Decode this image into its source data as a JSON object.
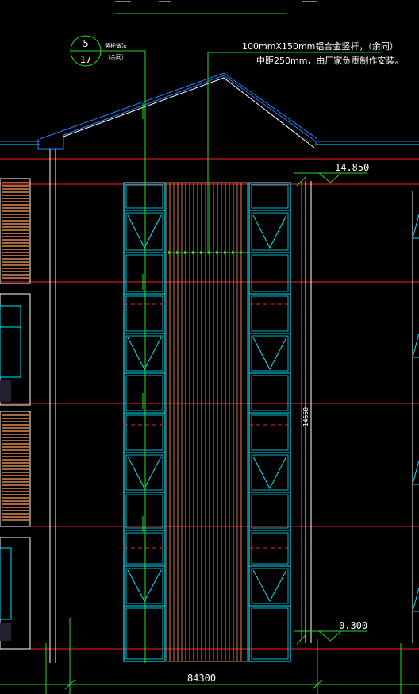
{
  "annotation": {
    "line1": "100mmX150mm铝合金竖杆，（余同）",
    "line2": "中距250mm，由厂家负责制作安装。"
  },
  "detail_callout": {
    "number": "5",
    "sheet": "17",
    "label_line1": "竖杆做法",
    "label_line2": "（余同）"
  },
  "elevation_marks": {
    "top": "14.850",
    "bottom": "0.300"
  },
  "dimensions": {
    "vertical": "14550",
    "horizontal": "84300"
  },
  "colors": {
    "background": "#000000",
    "cyan": "#00e5ff",
    "green": "#22dd22",
    "red": "#ff2020",
    "white": "#ffffff",
    "orange": "#e08a4a",
    "blue": "#2a7fff"
  }
}
